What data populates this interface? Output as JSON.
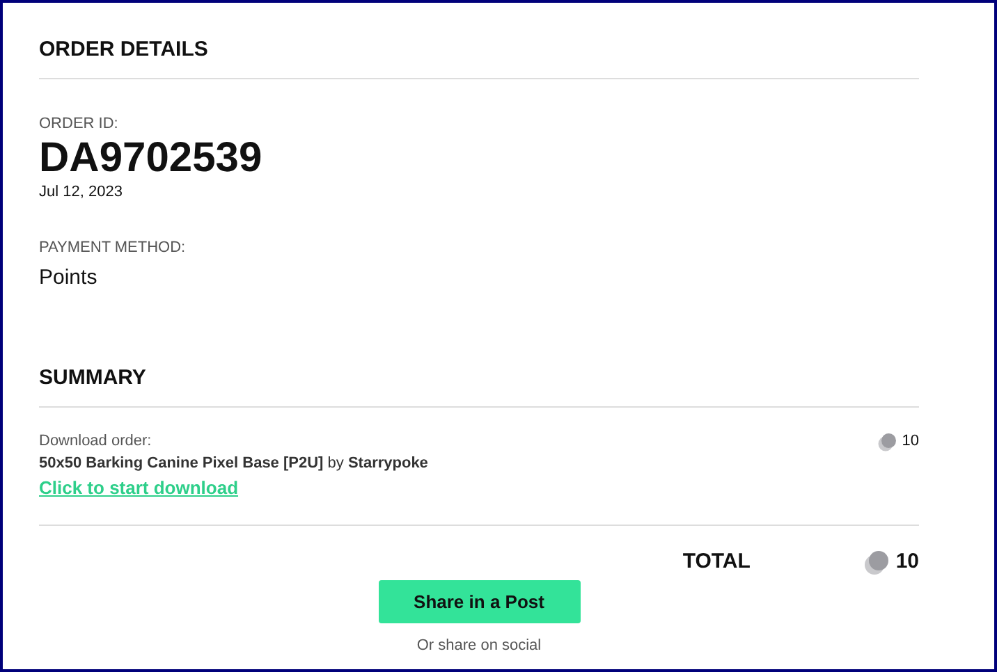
{
  "order_details": {
    "title": "ORDER DETAILS",
    "order_id_label": "ORDER ID:",
    "order_id": "DA9702539",
    "date": "Jul 12, 2023",
    "payment_label": "PAYMENT METHOD:",
    "payment_method": "Points"
  },
  "summary": {
    "title": "SUMMARY",
    "item_label": "Download order:",
    "item_text": "**50x50 Barking Canine Pixel Base [P2U]** by **Starrypoke**",
    "download_link": "Click to start download",
    "item_points": "10",
    "total_label": "TOTAL",
    "total_points": "10"
  },
  "share_button": "Share in a Post",
  "share_social": "Or share on social"
}
